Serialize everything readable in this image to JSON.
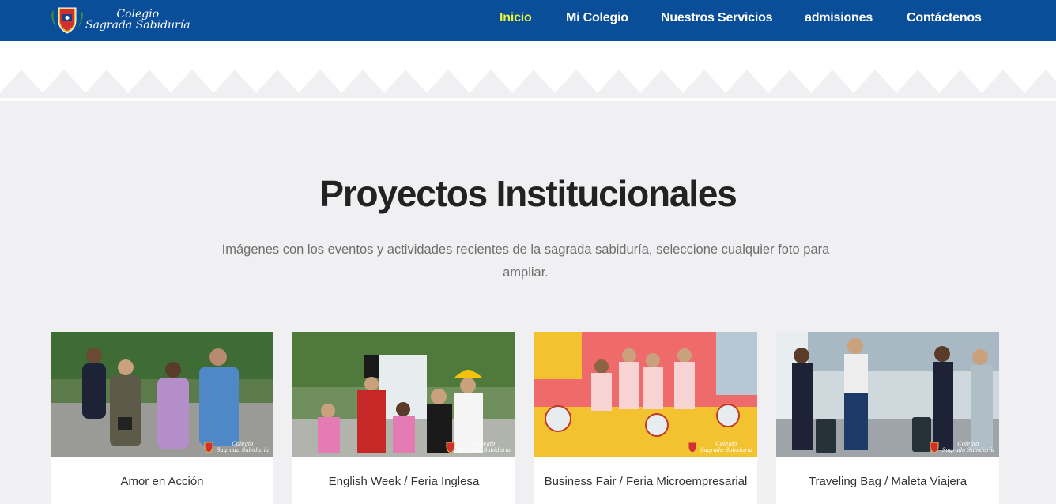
{
  "brand": {
    "line1": "Colegio",
    "line2": "Sagrada Sabiduría"
  },
  "nav": {
    "items": [
      {
        "label": "Inicio",
        "active": true
      },
      {
        "label": "Mi Colegio",
        "active": false
      },
      {
        "label": "Nuestros Servicios",
        "active": false
      },
      {
        "label": "admisiones",
        "active": false
      },
      {
        "label": "Contáctenos",
        "active": false
      }
    ]
  },
  "colors": {
    "nav_bg": "#0a4d98",
    "active_link": "#e5f53a",
    "page_bg": "#f0f0f2"
  },
  "section": {
    "title": "Proyectos Institucionales",
    "subtitle": "Imágenes con los eventos y actividades recientes de la sagrada sabiduría, seleccione cualquier foto para ampliar."
  },
  "projects": [
    {
      "caption": "Amor en Acción",
      "watermark": {
        "line1": "Colegio",
        "line2": "Sagrada Sabiduría"
      }
    },
    {
      "caption": "English Week / Feria Inglesa",
      "watermark": {
        "line1": "Colegio",
        "line2": "Sagrada Sabiduría"
      }
    },
    {
      "caption": "Business Fair / Feria Microempresarial",
      "watermark": {
        "line1": "Colegio",
        "line2": "Sagrada Sabiduría"
      }
    },
    {
      "caption": "Traveling Bag / Maleta Viajera",
      "watermark": {
        "line1": "Colegio",
        "line2": "Sagrada Sabiduría"
      }
    }
  ]
}
